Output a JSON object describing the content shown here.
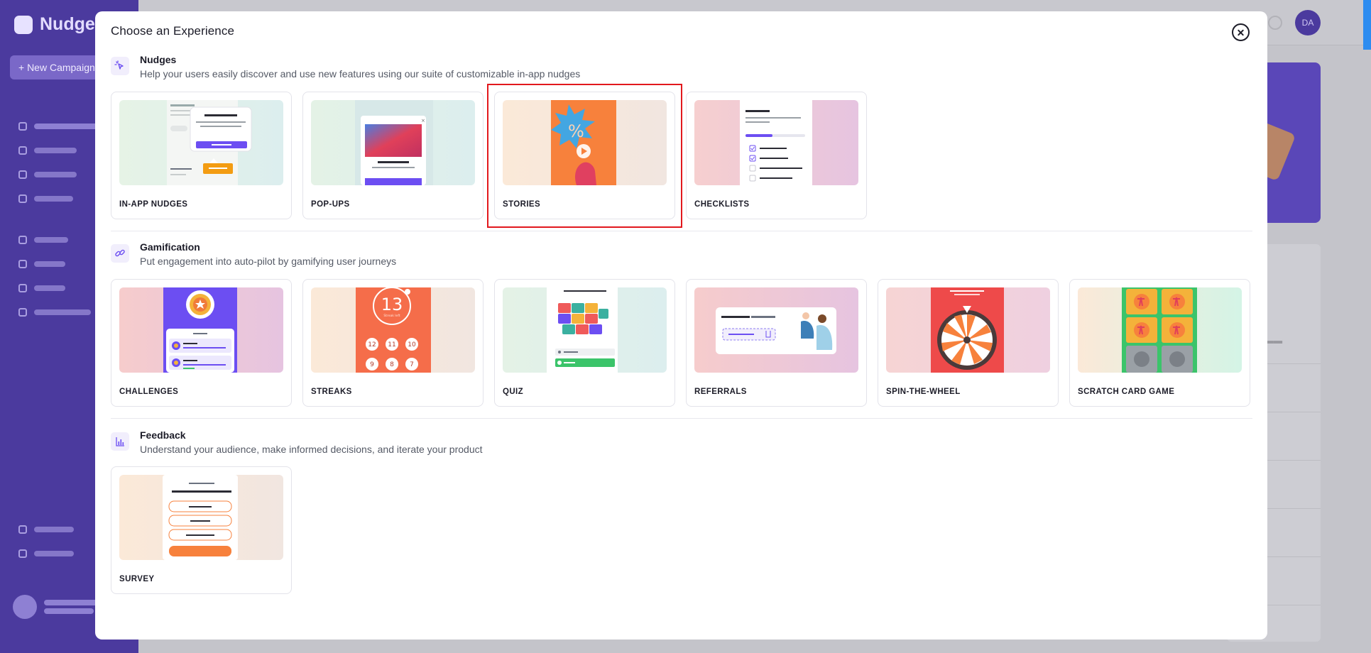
{
  "background_app": {
    "brand": "Nudge",
    "new_button": "+ New Campaign",
    "user_initials": "DA"
  },
  "modal": {
    "title": "Choose an Experience",
    "close_icon": "close-circle-icon",
    "sections": [
      {
        "id": "nudges",
        "title": "Nudges",
        "icon": "sparkle-cursor-icon",
        "description": "Help your users easily discover and use new features using our suite of customizable in-app nudges",
        "cards": [
          {
            "label": "IN-APP NUDGES"
          },
          {
            "label": "POP-UPS"
          },
          {
            "label": "STORIES",
            "selected": true
          },
          {
            "label": "CHECKLISTS"
          }
        ]
      },
      {
        "id": "gamification",
        "title": "Gamification",
        "icon": "chain-link-icon",
        "description": "Put engagement into auto-pilot by gamifying user journeys",
        "cards": [
          {
            "label": "CHALLENGES"
          },
          {
            "label": "STREAKS"
          },
          {
            "label": "QUIZ"
          },
          {
            "label": "REFERRALS"
          },
          {
            "label": "SPIN-THE-WHEEL"
          },
          {
            "label": "SCRATCH CARD GAME"
          }
        ]
      },
      {
        "id": "feedback",
        "title": "Feedback",
        "icon": "bar-chart-icon",
        "description": "Understand your audience, make informed decisions, and iterate your product",
        "cards": [
          {
            "label": "SURVEY"
          }
        ]
      }
    ]
  },
  "thumbnails": {
    "stories_badge": "%",
    "streak_day": "13",
    "streak_sub": "Streak left",
    "streak_days": [
      "12",
      "11",
      "10",
      "9",
      "8",
      "7"
    ]
  },
  "colors": {
    "accent": "#6c4ef2",
    "sidebar": "#4b3a9e",
    "highlight": "#e2181d",
    "stories_orange": "#f7813c"
  }
}
